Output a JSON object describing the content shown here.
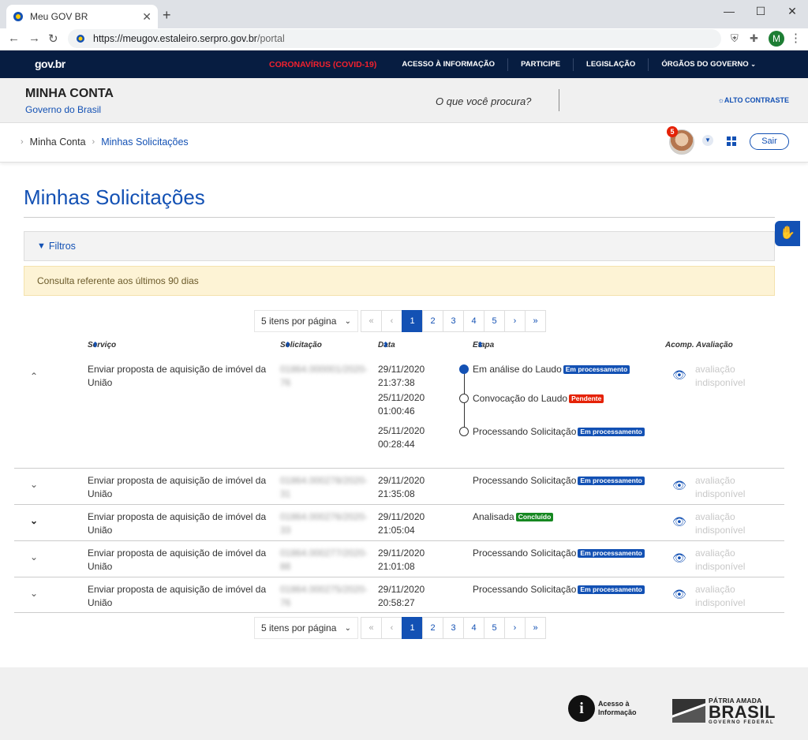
{
  "browser": {
    "tab_title": "Meu GOV BR",
    "tab_close": "✕",
    "new_tab": "+",
    "url_host": "https://meugov.estaleiro.serpro.gov.br",
    "url_path": "/portal",
    "profile_initial": "M",
    "win_min": "—",
    "win_max": "☐",
    "win_close": "✕"
  },
  "gov_header": {
    "logo": "gov.br",
    "links": [
      "CORONAVÍRUS (COVID-19)",
      "ACESSO À INFORMAÇÃO",
      "PARTICIPE",
      "LEGISLAÇÃO",
      "ÓRGÃOS DO GOVERNO"
    ],
    "covid_color": "#f3212e",
    "bar_color": "#071d41"
  },
  "account_header": {
    "title": "MINHA CONTA",
    "subtitle": "Governo do Brasil",
    "search_prompt": "O que você procura?",
    "contrast": "ALTO CONTRASTE"
  },
  "breadcrumb": {
    "items": [
      "Minha Conta",
      "Minhas Solicitações"
    ]
  },
  "user": {
    "notifications": "5",
    "logout": "Sair"
  },
  "page": {
    "title": "Minhas Solicitações",
    "filters_label": "Filtros",
    "alert": "Consulta referente aos últimos 90 dias",
    "accent": "#1351b4"
  },
  "pagination": {
    "per_page": "5 itens por página",
    "first": "«",
    "prev": "‹",
    "pages": [
      "1",
      "2",
      "3",
      "4",
      "5"
    ],
    "current": "1",
    "next": "›",
    "last": "»"
  },
  "table": {
    "headers": {
      "servico": "Serviço",
      "solicitacao": "Solicitação",
      "data": "Data",
      "etapa": "Etapa",
      "acomp": "Acomp.",
      "avaliacao": "Avaliação"
    },
    "rows": [
      {
        "servico": "Enviar proposta de aquisição de imóvel da União",
        "solicitacao": "01864.000001/2020-76",
        "avaliacao": "avaliação indisponível",
        "expanded": true,
        "steps": [
          {
            "date": "29/11/2020",
            "time": "21:37:38",
            "etapa": "Em análise do Laudo",
            "status": "Em processamento"
          },
          {
            "date": "25/11/2020",
            "time": "01:00:46",
            "etapa": "Convocação do Laudo",
            "status": "Pendente"
          },
          {
            "date": "25/11/2020",
            "time": "00:28:44",
            "etapa": "Processando Solicitação",
            "status": "Em processamento"
          }
        ]
      },
      {
        "servico": "Enviar proposta de aquisição de imóvel da União",
        "solicitacao": "01864.000278/2020-31",
        "date": "29/11/2020",
        "time": "21:35:08",
        "etapa": "Processando Solicitação",
        "status": "Em processamento",
        "avaliacao": "avaliação indisponível"
      },
      {
        "servico": "Enviar proposta de aquisição de imóvel da União",
        "solicitacao": "01864.000276/2020-33",
        "date": "29/11/2020",
        "time": "21:05:04",
        "etapa": "Analisada",
        "status": "Concluído",
        "avaliacao": "avaliação indisponível"
      },
      {
        "servico": "Enviar proposta de aquisição de imóvel da União",
        "solicitacao": "01864.000277/2020-88",
        "date": "29/11/2020",
        "time": "21:01:08",
        "etapa": "Processando Solicitação",
        "status": "Em processamento",
        "avaliacao": "avaliação indisponível"
      },
      {
        "servico": "Enviar proposta de aquisição de imóvel da União",
        "solicitacao": "01864.000275/2020-76",
        "date": "29/11/2020",
        "time": "20:58:27",
        "etapa": "Processando Solicitação",
        "status": "Em processamento",
        "avaliacao": "avaliação indisponível"
      }
    ]
  },
  "footer": {
    "acesso_info": "Acesso à Informação",
    "brasil_top": "PÁTRIA AMADA",
    "brasil_main": "BRASIL",
    "brasil_sub": "GOVERNO FEDERAL"
  }
}
